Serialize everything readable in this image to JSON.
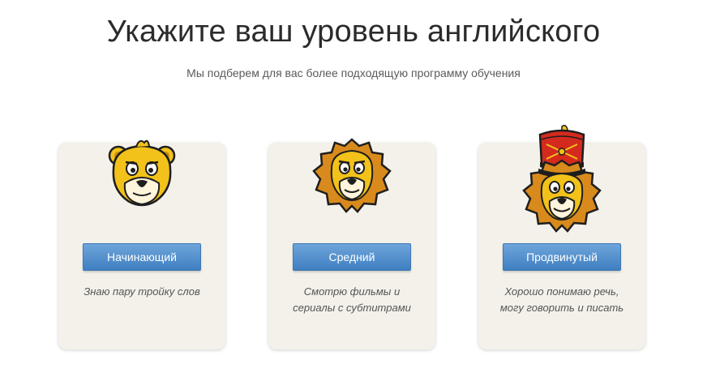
{
  "header": {
    "title": "Укажите ваш уровень английского",
    "subtitle": "Мы подберем для вас более подходящую программу обучения"
  },
  "levels": [
    {
      "mascot_icon": "lion-cub-icon",
      "button_label": "Начинающий",
      "description": "Знаю пару тройку слов"
    },
    {
      "mascot_icon": "lion-icon",
      "button_label": "Средний",
      "description": "Смотрю фильмы и сериалы с субтитрами"
    },
    {
      "mascot_icon": "lion-with-hussar-hat-icon",
      "button_label": "Продвинутый",
      "description": "Хорошо понимаю речь, могу говорить и писать"
    }
  ],
  "colors": {
    "card_background": "#f3f1ea",
    "button_top": "#6ea5db",
    "button_bottom": "#3f7fc1",
    "title_text": "#2b2b2b",
    "mascot_yellow": "#f2c21a",
    "mane_orange": "#d88a1c",
    "hat_red": "#d42a1e"
  }
}
